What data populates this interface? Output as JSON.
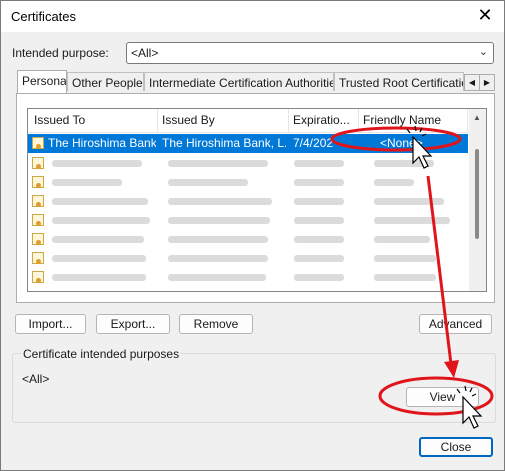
{
  "window": {
    "title": "Certificates"
  },
  "purpose": {
    "label": "Intended purpose:",
    "value": "<All>"
  },
  "tabs": [
    "Personal",
    "Other People",
    "Intermediate Certification Authorities",
    "Trusted Root Certification"
  ],
  "columns": [
    "Issued To",
    "Issued By",
    "Expiratio...",
    "Friendly Name"
  ],
  "selected_row": {
    "issued_to": "The Hiroshima Bank...",
    "issued_by": "The Hiroshima Bank, L...",
    "expiration": "7/4/202",
    "friendly_name": "<None>"
  },
  "buttons": {
    "import": "Import...",
    "export": "Export...",
    "remove": "Remove",
    "advanced": "Advanced",
    "view": "View",
    "close": "Close"
  },
  "intended_purposes": {
    "label": "Certificate intended purposes",
    "value": "<All>"
  },
  "colors": {
    "selection": "#0078d7",
    "annotation": "#e0141b"
  }
}
